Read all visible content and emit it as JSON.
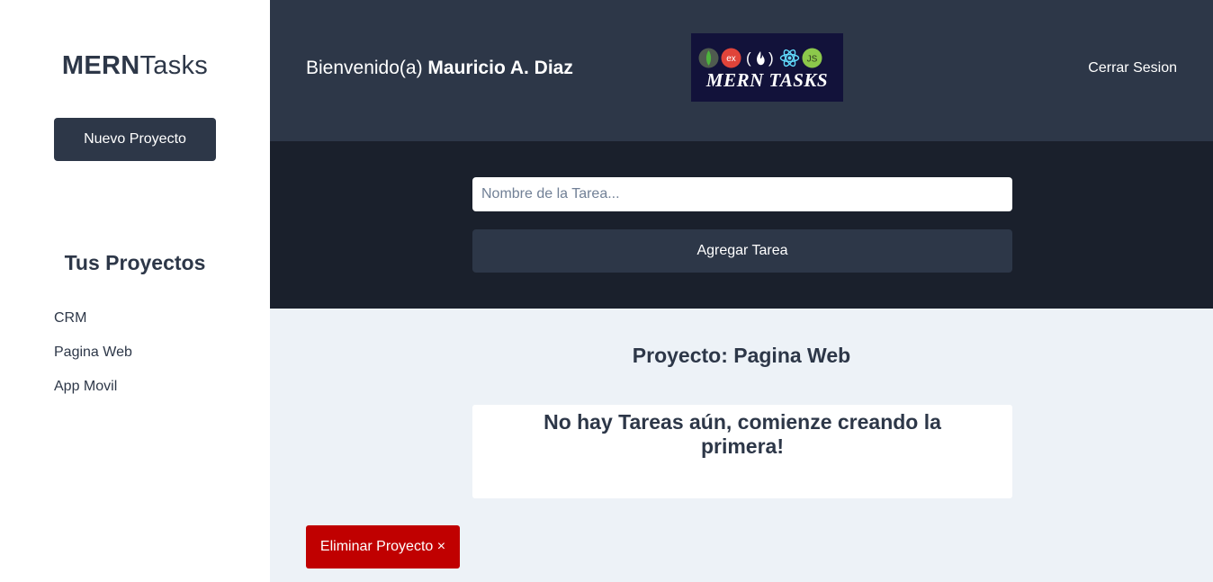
{
  "sidebar": {
    "brand_bold": "MERN",
    "brand_light": "Tasks",
    "new_project_label": "Nuevo Proyecto",
    "projects_title": "Tus Proyectos",
    "projects": [
      {
        "label": "CRM"
      },
      {
        "label": "Pagina Web"
      },
      {
        "label": "App Movil"
      }
    ]
  },
  "header": {
    "welcome_prefix": "Bienvenido(a) ",
    "user_name": "Mauricio A. Diaz",
    "logo_text": "MERN TASKS",
    "logout_label": "Cerrar Sesion"
  },
  "task_form": {
    "input_value": "",
    "input_placeholder": "Nombre de la Tarea...",
    "add_label": "Agregar Tarea"
  },
  "main": {
    "project_heading": "Proyecto: Pagina Web",
    "empty_message": "No hay Tareas aún, comienze creando la primera!",
    "delete_label": "Eliminar Proyecto ×"
  },
  "colors": {
    "sidebar_bg": "#ffffff",
    "header_bg": "#2d3748",
    "form_bg": "#1a202c",
    "main_bg": "#edf2f7",
    "primary": "#2d3748",
    "danger": "#c00000"
  },
  "icons": [
    "mongodb-icon",
    "express-icon",
    "freecodecamp-icon",
    "react-icon",
    "nodejs-icon"
  ]
}
